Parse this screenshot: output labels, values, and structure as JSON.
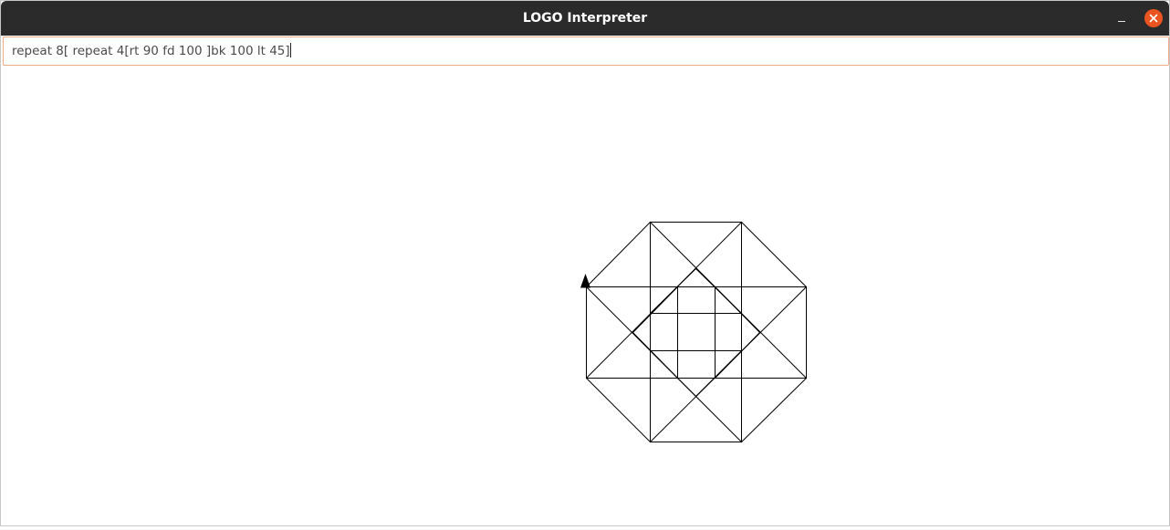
{
  "window": {
    "title": "LOGO Interpreter",
    "accent_close_color": "#e95420"
  },
  "controls": {
    "minimize_icon": "minimize-icon",
    "close_icon": "close-icon"
  },
  "command": {
    "value": "repeat 8[ repeat 4[rt 90 fd 100 ]bk 100 lt 45]"
  },
  "turtle": {
    "icon": "turtle-triangle-icon"
  }
}
